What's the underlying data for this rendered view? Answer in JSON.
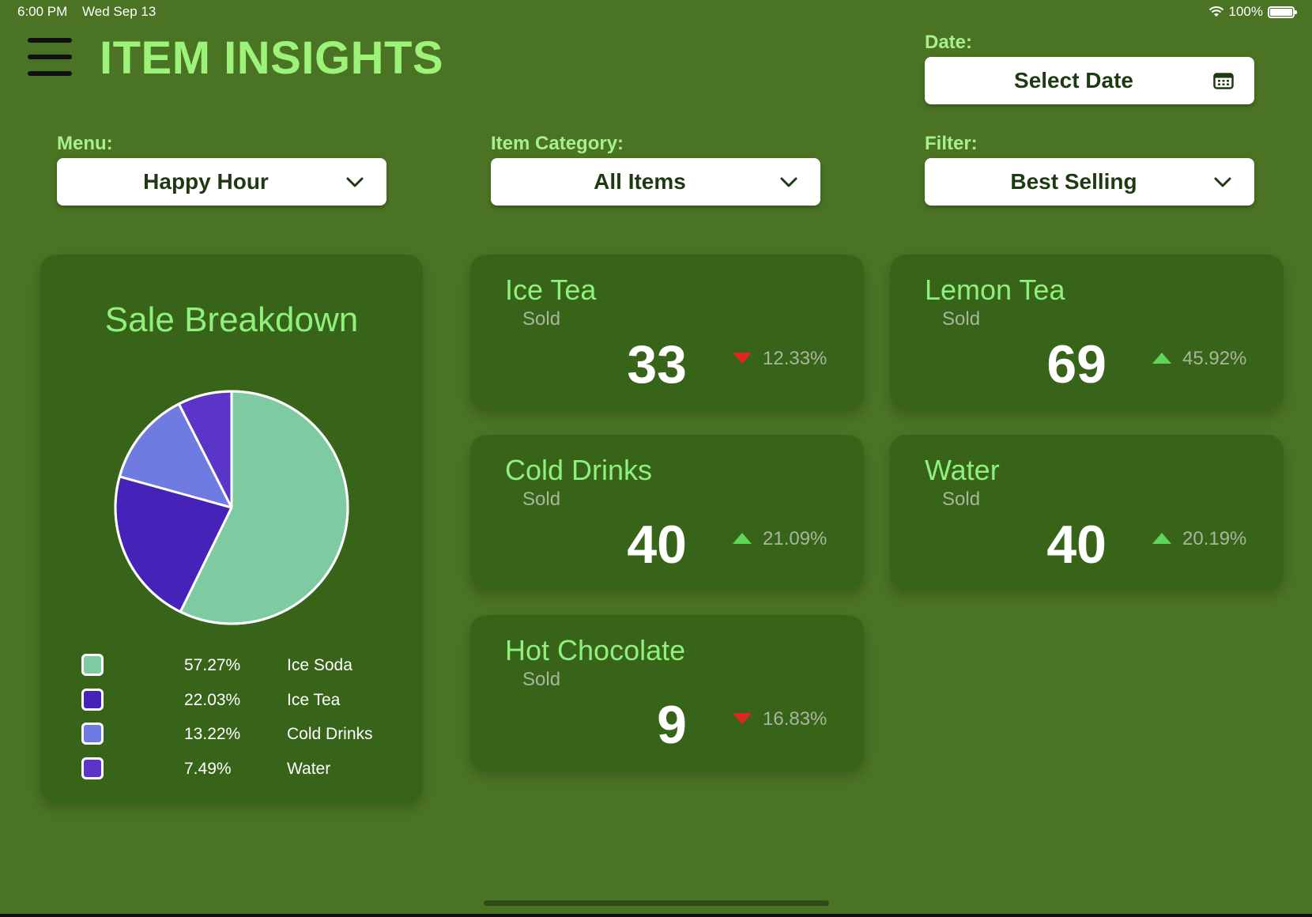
{
  "status": {
    "time": "6:00 PM",
    "date": "Wed Sep 13",
    "battery": "100%"
  },
  "header": {
    "title": "ITEM INSIGHTS"
  },
  "date_filter": {
    "label": "Date:",
    "value": "Select Date"
  },
  "menu_filter": {
    "label": "Menu:",
    "value": "Happy Hour"
  },
  "category_filter": {
    "label": "Item Category:",
    "value": "All Items"
  },
  "sort_filter": {
    "label": "Filter:",
    "value": "Best Selling"
  },
  "sale_breakdown": {
    "title": "Sale Breakdown",
    "legend": [
      {
        "pct": "57.27%",
        "name": "Ice Soda",
        "color": "#7ecba1"
      },
      {
        "pct": "22.03%",
        "name": "Ice Tea",
        "color": "#4522b8"
      },
      {
        "pct": "13.22%",
        "name": "Cold Drinks",
        "color": "#6f7be0"
      },
      {
        "pct": "7.49%",
        "name": "Water",
        "color": "#5a35c8"
      }
    ]
  },
  "chart_data": {
    "type": "pie",
    "title": "Sale Breakdown",
    "categories": [
      "Ice Soda",
      "Ice Tea",
      "Cold Drinks",
      "Water"
    ],
    "values": [
      57.27,
      22.03,
      13.22,
      7.49
    ],
    "colors": [
      "#7ecba1",
      "#4522b8",
      "#6f7be0",
      "#5a35c8"
    ],
    "legend_position": "bottom"
  },
  "items": [
    {
      "name": "Ice Tea",
      "sub": "Sold",
      "count": "33",
      "direction": "down",
      "pct": "12.33%"
    },
    {
      "name": "Lemon Tea",
      "sub": "Sold",
      "count": "69",
      "direction": "up",
      "pct": "45.92%"
    },
    {
      "name": "Cold Drinks",
      "sub": "Sold",
      "count": "40",
      "direction": "up",
      "pct": "21.09%"
    },
    {
      "name": "Water",
      "sub": "Sold",
      "count": "40",
      "direction": "up",
      "pct": "20.19%"
    },
    {
      "name": "Hot Chocolate",
      "sub": "Sold",
      "count": "9",
      "direction": "down",
      "pct": "16.83%"
    }
  ],
  "colors": {
    "up": "#5fd65a",
    "down": "#e0261f"
  }
}
